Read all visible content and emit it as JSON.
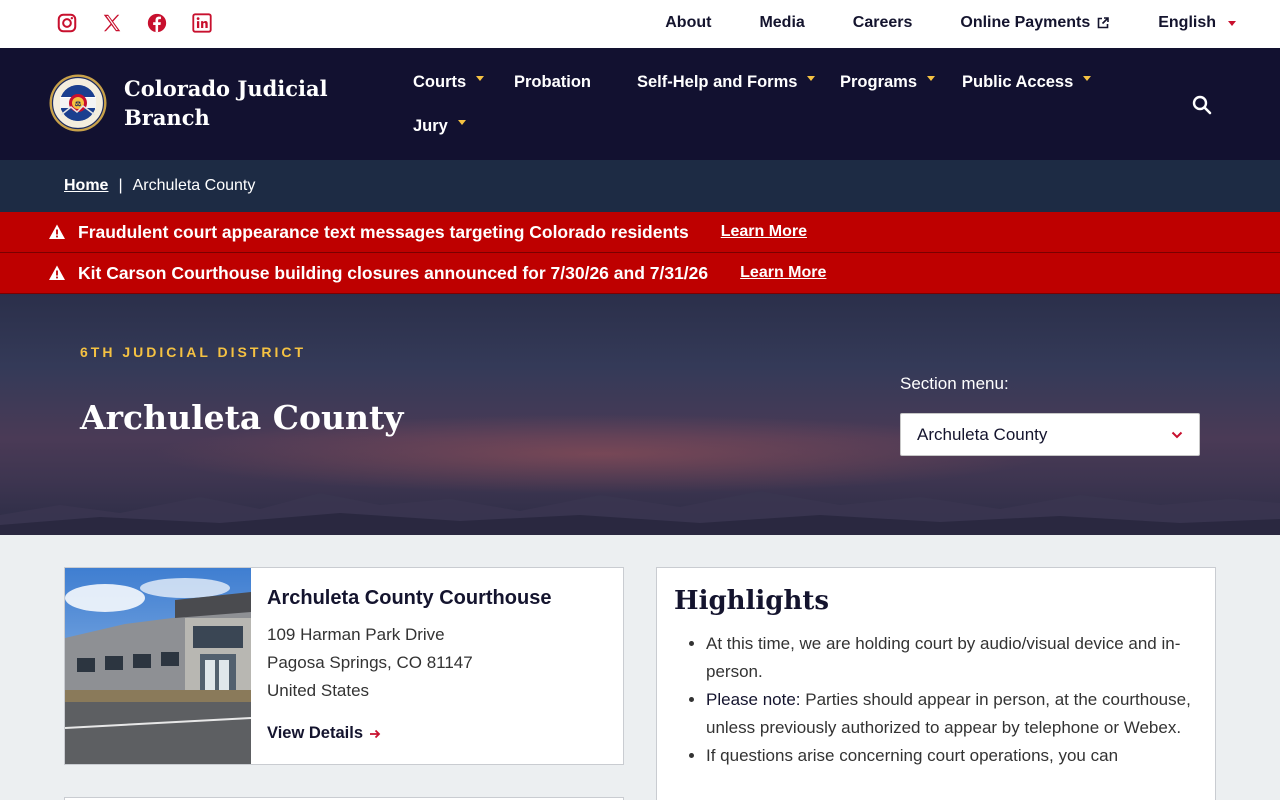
{
  "social": {
    "icons": [
      "instagram-icon",
      "x-icon",
      "facebook-icon",
      "linkedin-icon"
    ],
    "color": "#c8102e"
  },
  "utility_nav": {
    "about": "About",
    "media": "Media",
    "careers": "Careers",
    "online_payments": "Online Payments",
    "language": "English"
  },
  "brand": {
    "name": "Colorado Judicial Branch"
  },
  "main_nav": {
    "courts": "Courts",
    "probation": "Probation",
    "self_help": "Self-Help and Forms",
    "programs": "Programs",
    "public_access": "Public Access",
    "jury": "Jury"
  },
  "breadcrumb": {
    "home": "Home",
    "current": "Archuleta County"
  },
  "alerts": [
    {
      "text": "Fraudulent court appearance text messages targeting Colorado residents",
      "link": "Learn More"
    },
    {
      "text": "Kit Carson Courthouse building closures announced for 7/30/26 and 7/31/26",
      "link": "Learn More"
    }
  ],
  "hero": {
    "district": "6TH JUDICIAL DISTRICT",
    "title": "Archuleta County",
    "section_menu_label": "Section menu:",
    "section_menu_value": "Archuleta County"
  },
  "courthouse": {
    "name": "Archuleta County Courthouse",
    "address_line1": "109 Harman Park Drive",
    "address_line2": "Pagosa Springs, CO 81147",
    "address_line3": "United States",
    "link": "View Details"
  },
  "highlights": {
    "title": "Highlights",
    "item1": "At this time, we are holding court by audio/visual device and in-person.",
    "item2_label": "Please note:",
    "item2_text": " Parties should appear in person, at the courthouse, unless previously authorized to appear by telephone or Webex.",
    "item3": "If questions arise concerning court operations, you can"
  },
  "colors": {
    "navy": "#121130",
    "breadcrumb_bg": "#1d2b44",
    "alert_red": "#be0000",
    "gold": "#f5c242",
    "accent_red": "#c8102e"
  }
}
